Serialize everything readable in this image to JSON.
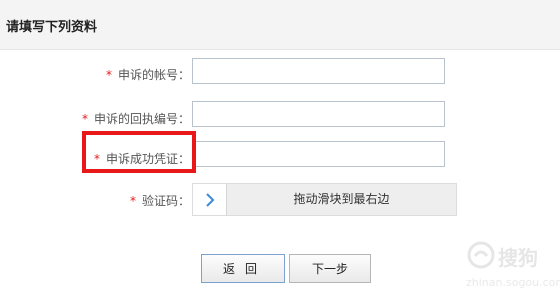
{
  "section": {
    "title": "请填写下列资料"
  },
  "form": {
    "required_mark": "*",
    "fields": [
      {
        "label": "申诉的帐号：",
        "value": "",
        "placeholder": ""
      },
      {
        "label": "申诉的回执编号：",
        "value": "",
        "placeholder": ""
      },
      {
        "label": "申诉成功凭证：",
        "value": "",
        "placeholder": ""
      }
    ],
    "captcha": {
      "label": "验证码：",
      "handle_glyph": "›",
      "text": "拖动滑块到最右边"
    }
  },
  "buttons": {
    "back": "返回",
    "next": "下一步"
  },
  "watermark": {
    "text": "搜狗",
    "url": "zhinan.sogou.com"
  },
  "colors": {
    "required": "#e02020",
    "highlight": "#e81818",
    "handle_arrow": "#3d8ad8"
  }
}
